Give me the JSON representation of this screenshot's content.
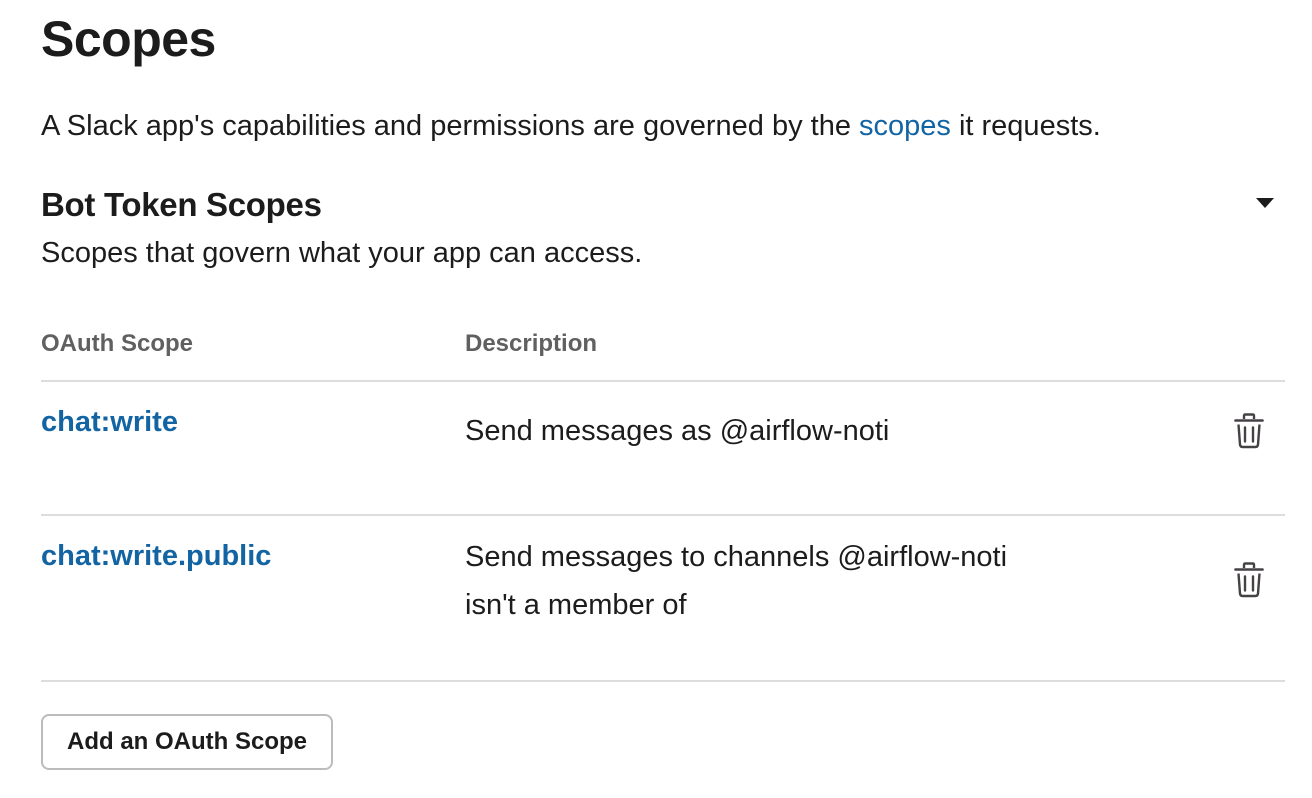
{
  "page": {
    "title": "Scopes",
    "intro_before": "A Slack app's capabilities and permissions are governed by the ",
    "intro_link": "scopes",
    "intro_after": " it requests."
  },
  "bot_scopes": {
    "title": "Bot Token Scopes",
    "subtitle": "Scopes that govern what your app can access.",
    "toggle_icon": "caret-down-icon",
    "columns": {
      "scope": "OAuth Scope",
      "description": "Description"
    },
    "rows": [
      {
        "scope": "chat:write",
        "description": "Send messages as @airflow-noti",
        "action_icon": "trash-icon"
      },
      {
        "scope": "chat:write.public",
        "description_line1": "Send messages to channels @airflow-noti",
        "description_line2": "isn't a member of",
        "action_icon": "trash-icon"
      }
    ],
    "add_button_label": "Add an OAuth Scope"
  },
  "colors": {
    "link": "#1264a3",
    "text": "#1d1c1d",
    "muted": "#616061",
    "divider": "#dddddd",
    "button_border": "#bcbcbc"
  }
}
